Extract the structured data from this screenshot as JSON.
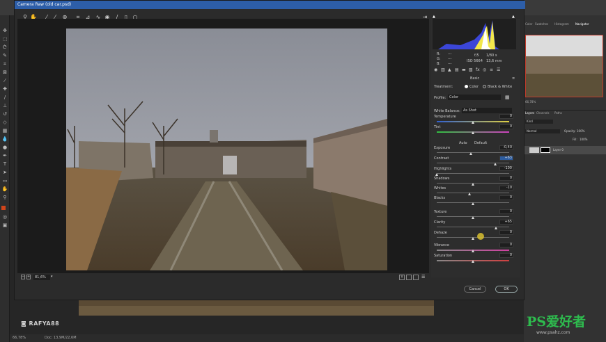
{
  "dialog": {
    "title": "Camera Raw (old car.psd)",
    "zoom": "81,6%",
    "cancel_label": "Cancel",
    "ok_label": "OK"
  },
  "toolbar": {
    "icons": [
      "zoom-icon",
      "hand-icon",
      "white-balance-icon",
      "color-sampler-icon",
      "targeted-adjustment-icon",
      "crop-icon",
      "straighten-icon",
      "spot-removal-icon",
      "red-eye-icon",
      "adjustment-brush-icon",
      "graduated-filter-icon",
      "radial-filter-icon"
    ]
  },
  "histogram": {
    "r_label": "R:",
    "g_label": "G:",
    "b_label": "B:",
    "r_val": "---",
    "g_val": "---",
    "b_val": "---",
    "aperture": "f/5",
    "shutter": "1/80 s",
    "iso": "ISO 5664",
    "focal": "13,6 mm"
  },
  "panel": {
    "section": "Basic",
    "treatment_label": "Treatment:",
    "color_option": "Color",
    "bw_option": "Black & White",
    "profile_label": "Profile:",
    "profile_value": "Color",
    "wb_label": "White Balance:",
    "wb_value": "As Shot",
    "auto_label": "Auto",
    "default_label": "Default",
    "sliders": [
      {
        "label": "Temperature",
        "value": "0",
        "pos": 0.5
      },
      {
        "label": "Tint",
        "value": "0",
        "pos": 0.5
      },
      {
        "label": "Exposure",
        "value": "-0,40",
        "pos": 0.47
      },
      {
        "label": "Contrast",
        "value": "+63",
        "pos": 0.81
      },
      {
        "label": "Highlights",
        "value": "-100",
        "pos": 0.0
      },
      {
        "label": "Shadows",
        "value": "0",
        "pos": 0.5
      },
      {
        "label": "Whites",
        "value": "-10",
        "pos": 0.45
      },
      {
        "label": "Blacks",
        "value": "0",
        "pos": 0.5
      },
      {
        "label": "Texture",
        "value": "0",
        "pos": 0.5
      },
      {
        "label": "Clarity",
        "value": "+65",
        "pos": 0.82
      },
      {
        "label": "Dehaze",
        "value": "0",
        "pos": 0.5
      },
      {
        "label": "Vibrance",
        "value": "0",
        "pos": 0.5
      },
      {
        "label": "Saturation",
        "value": "0",
        "pos": 0.5
      }
    ]
  },
  "ps": {
    "tabs": [
      "Color",
      "Swatches",
      "Histogram",
      "Navigator"
    ],
    "layers_tabs": [
      "Layers",
      "Channels",
      "Paths"
    ],
    "blend": "Normal",
    "opacity_label": "Opacity:",
    "opacity": "100%",
    "fill_label": "Fill:",
    "fill": "100%",
    "kind": "Kind",
    "layer_name": "Layer 0",
    "status_zoom": "66,78%",
    "status_doc": "Doc: 13,9M/22,6M",
    "nav_zoom": "66,78%"
  },
  "watermark": "RAFYA88",
  "site_logo": "PS爱好者",
  "site_url": "www.psahz.com"
}
